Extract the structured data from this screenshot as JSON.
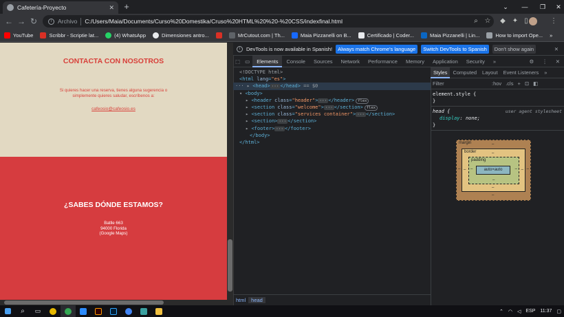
{
  "browser": {
    "tab_title": "Cafetería-Proyecto",
    "omnibox_label": "Archivo",
    "url": "C:/Users/Maia/Documents/Curso%20Domestika/Cruso%20HTML%20%20-%20CSS/indexfinal.html",
    "bookmarks": [
      {
        "label": "YouTube",
        "color": "#ff0000"
      },
      {
        "label": "Scribbr - Scriptie lat...",
        "color": "#d93025"
      },
      {
        "label": "(4) WhatsApp",
        "color": "#25d366"
      },
      {
        "label": "Dimensiones antro...",
        "color": "#e8eaed"
      },
      {
        "label": "",
        "color": "#d93025"
      },
      {
        "label": "MrCutout.com | Th...",
        "color": "#5f6368"
      },
      {
        "label": "Maia Pizzanelli on B...",
        "color": "#1769ff"
      },
      {
        "label": "Certificado | Coder...",
        "color": "#e8eaed"
      },
      {
        "label": "Maia Pizzanelli | Lin...",
        "color": "#0a66c2"
      },
      {
        "label": "How to import Ope...",
        "color": "#9aa0a6"
      }
    ],
    "icons": {
      "more": "⋮",
      "bookmarks_more": "»"
    }
  },
  "page": {
    "contact": {
      "heading": "CONTACTA CON NOSOTROS",
      "body": "Si quieres hacer una reserva, tienes alguna sugerencia o simplemente quieres saludar, escríbenos a:",
      "email": "cafeosio@cafeosio.es"
    },
    "visit": {
      "heading": "¿SABES DÓNDE ESTAMOS?",
      "address_line1": "Batlle 663",
      "address_line2": "94000 Florida",
      "address_line3": "(Google Maps)"
    },
    "colors": {
      "accent": "#d8403a",
      "beige": "#e2d9c2",
      "red": "#d63c3f"
    }
  },
  "devtools": {
    "info_text": "DevTools is now available in Spanish!",
    "btn_match": "Always match Chrome's language",
    "btn_switch": "Switch DevTools to Spanish",
    "btn_dont": "Don't show again",
    "tabs": [
      "Elements",
      "Console",
      "Sources",
      "Network",
      "Performance",
      "Memory",
      "Application",
      "Security"
    ],
    "dom": {
      "doctype": "<!DOCTYPE html>",
      "lang": "es",
      "selected_marker": "== $0",
      "header_class": "header",
      "welcome_class": "welcome",
      "services_class": "services container",
      "flex_badge": "flex"
    },
    "breadcrumbs": [
      "html",
      "head"
    ],
    "styles_tabs": [
      "Styles",
      "Computed",
      "Layout",
      "Event Listeners"
    ],
    "filter_placeholder": "Filter",
    "filter_hov": ":hov",
    "filter_cls": ".cls",
    "rules": {
      "element_style": "element.style {",
      "selector": "head {",
      "source": "user agent stylesheet",
      "prop": "display",
      "value": "none;"
    },
    "boxmodel": {
      "margin": "margin",
      "border": "border",
      "padding": "padding",
      "content": "auto×auto",
      "dash": "–"
    }
  },
  "taskbar": {
    "lang": "ESP",
    "time": "11:37"
  }
}
